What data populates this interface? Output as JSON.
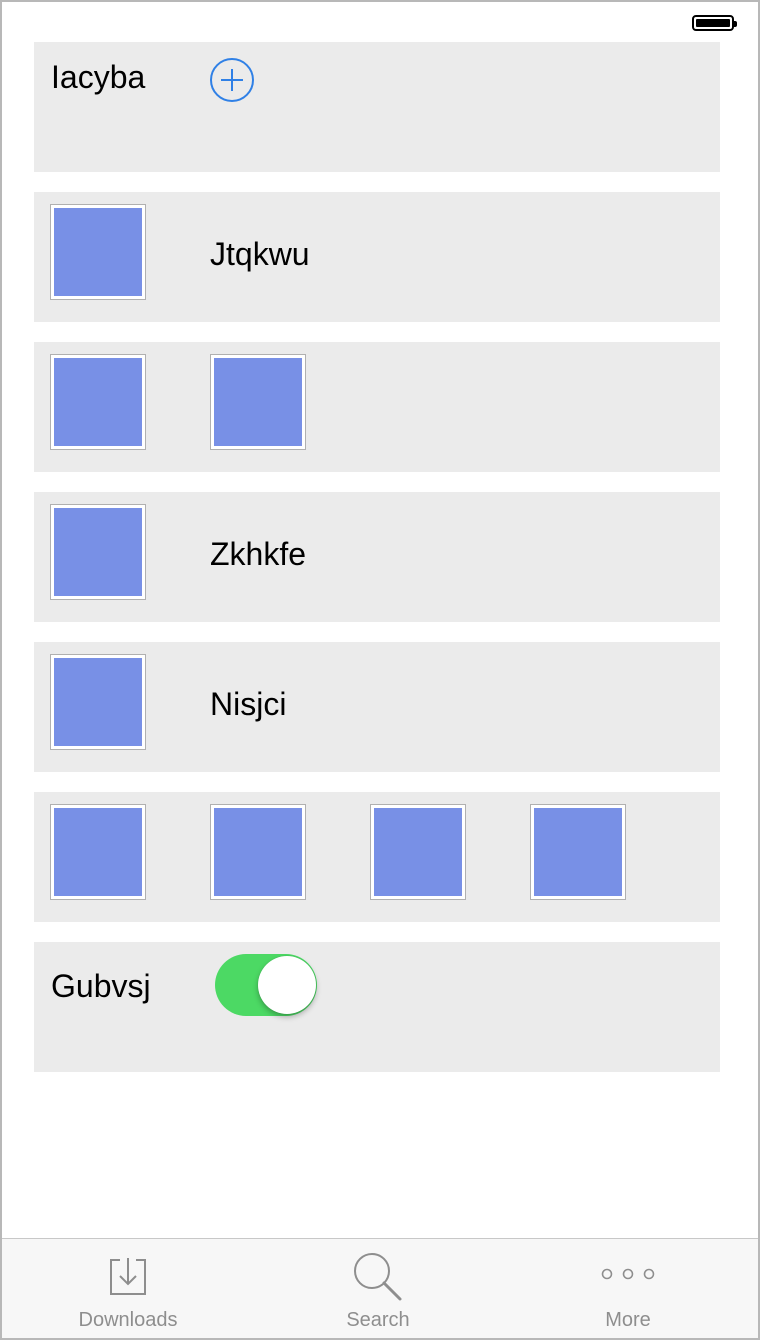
{
  "rows": {
    "row1": {
      "label": "Iacyba",
      "icon": "plus-circle-icon"
    },
    "row2": {
      "label": "Jtqkwu"
    },
    "row4": {
      "label": "Zkhkfe"
    },
    "row5": {
      "label": "Nisjci"
    },
    "row7": {
      "label": "Gubvsj",
      "toggle_on": true
    }
  },
  "tabs": [
    {
      "label": "Downloads",
      "icon": "download-icon"
    },
    {
      "label": "Search",
      "icon": "search-icon"
    },
    {
      "label": "More",
      "icon": "more-icon"
    }
  ],
  "colors": {
    "accent": "#2f80e6",
    "toggle_on": "#4cd964",
    "thumbnail": "#7890e6",
    "row_background": "#ebebeb",
    "tab_label": "#8e8e8e"
  }
}
